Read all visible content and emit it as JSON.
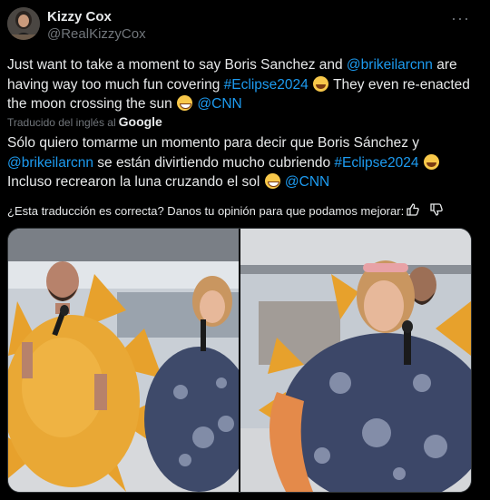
{
  "author": {
    "display_name": "Kizzy Cox",
    "handle": "@RealKizzyCox"
  },
  "tweet": {
    "original": {
      "part1": "Just want to take a moment to say Boris Sanchez and ",
      "mention1": "@brikeilarcnn",
      "part2": " are having way too much fun covering ",
      "hashtag": "#Eclipse2024",
      "part3": " They even re-enacted the moon crossing the sun ",
      "mention2": "@CNN"
    },
    "translated_by": "Traducido del inglés al",
    "translator": "Google",
    "translation": {
      "part1": "Sólo quiero tomarme un momento para decir que Boris Sánchez y ",
      "mention1": "@brikeilarcnn",
      "part2": " se están divirtiendo mucho cubriendo ",
      "hashtag": "#Eclipse2024",
      "part3": " Incluso recrearon la luna cruzando el sol ",
      "mention2": "@CNN"
    },
    "feedback_prompt": "¿Esta traducción es correcta? Danos tu opinión para que podamos mejorar:"
  },
  "icons": {
    "more": "more-options-icon",
    "thumbs_up": "thumbs-up-icon",
    "thumbs_down": "thumbs-down-icon"
  },
  "colors": {
    "background": "#000000",
    "text": "#e7e9ea",
    "secondary": "#71767b",
    "link": "#1d9bf0"
  }
}
